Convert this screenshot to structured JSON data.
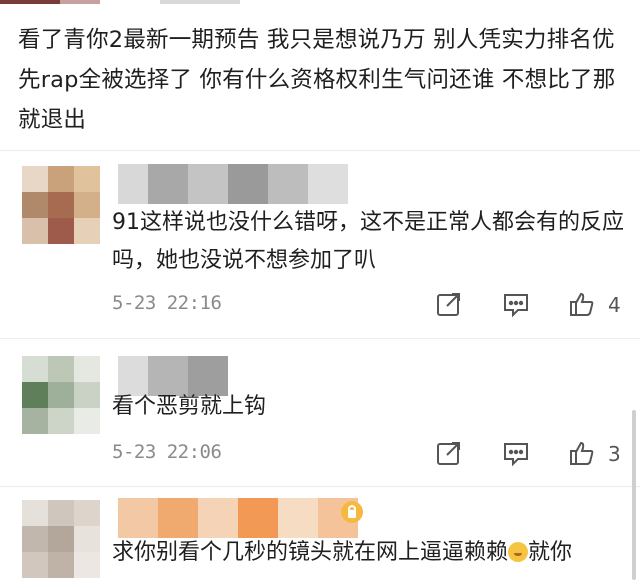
{
  "post": {
    "text": "看了青你2最新一期预告 我只是想说乃万 别人凭实力排名优先rap全被选择了 你有什么资格权利生气问还谁 不想比了那就退出"
  },
  "comments": [
    {
      "text": "91这样说也没什么错呀，这不是正常人都会有的反应吗，她也没说不想参加了叭",
      "time": "5-23 22:16",
      "likes": "4"
    },
    {
      "text": "看个恶剪就上钩",
      "time": "5-23 22:06",
      "likes": "3"
    },
    {
      "text_before": "求你别看个几秒的镜头就在网上逼逼赖赖",
      "text_after": "就你"
    }
  ],
  "icons": {
    "share": "share-icon",
    "comment": "comment-icon",
    "like": "thumbs-up-icon"
  }
}
